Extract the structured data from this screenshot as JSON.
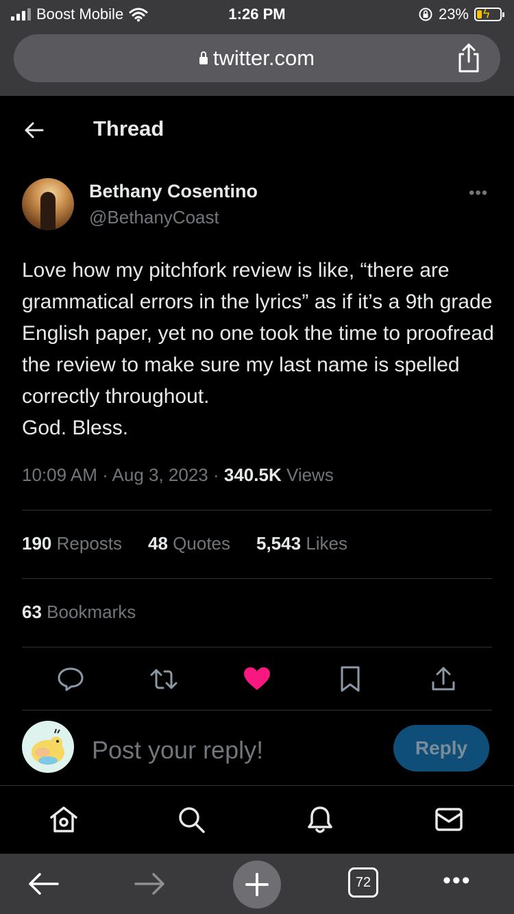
{
  "status_bar": {
    "carrier": "Boost Mobile",
    "time": "1:26 PM",
    "battery": "23%",
    "battery_level": 0.23
  },
  "browser": {
    "url": "twitter.com",
    "tab_count": "72"
  },
  "header": {
    "title": "Thread"
  },
  "tweet": {
    "author_name": "Bethany Cosentino",
    "author_handle": "@BethanyCoast",
    "text": "Love how my pitchfork review is like, “there are grammatical errors in the lyrics” as if it’s a 9th grade English paper, yet no one took the time to proofread the review to make sure my last name is spelled correctly throughout.\nGod. Bless.",
    "time": "10:09 AM",
    "date": "Aug 3, 2023",
    "views_count": "340.5K",
    "views_label": "Views",
    "reposts_count": "190",
    "reposts_label": "Reposts",
    "quotes_count": "48",
    "quotes_label": "Quotes",
    "likes_count": "5,543",
    "likes_label": "Likes",
    "bookmarks_count": "63",
    "bookmarks_label": "Bookmarks",
    "liked": true
  },
  "reply": {
    "placeholder": "Post your reply!",
    "button_label": "Reply"
  },
  "icons": {
    "back": "arrow-left-icon",
    "more": "more-horizontal-icon",
    "comment": "comment-icon",
    "repost": "repost-icon",
    "like": "heart-icon",
    "bookmark": "bookmark-icon",
    "share": "share-icon",
    "home": "home-icon",
    "search": "search-icon",
    "notifications": "bell-icon",
    "messages": "mail-icon"
  },
  "colors": {
    "background": "#000000",
    "like_active": "#f91880",
    "reply_button": "#0f4e78",
    "secondary_text": "#71767b"
  }
}
